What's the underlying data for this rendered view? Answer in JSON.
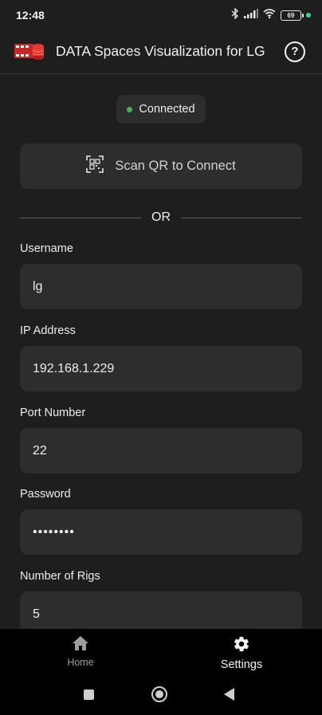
{
  "status_bar": {
    "time": "12:48",
    "battery": "69",
    "icons": [
      "bluetooth-icon",
      "signal-icon",
      "wifi-icon",
      "battery-icon"
    ]
  },
  "app_bar": {
    "title": "DATA Spaces Visualization for LG",
    "help_icon": "?"
  },
  "connection": {
    "status": "Connected",
    "status_color": "#4caf50"
  },
  "qr_button": {
    "label": "Scan QR to Connect",
    "icon": "qr-scan-icon"
  },
  "divider": {
    "label": "OR"
  },
  "form": {
    "username": {
      "label": "Username",
      "value": "lg"
    },
    "ip_address": {
      "label": "IP Address",
      "value": "192.168.1.229"
    },
    "port_number": {
      "label": "Port Number",
      "value": "22"
    },
    "password": {
      "label": "Password",
      "value": "••••••••"
    },
    "number_of_rigs": {
      "label": "Number of Rigs",
      "value": "5"
    }
  },
  "bottom_nav": {
    "items": [
      {
        "label": "Home",
        "icon": "home-icon",
        "active": false
      },
      {
        "label": "Settings",
        "icon": "gear-icon",
        "active": true
      }
    ]
  },
  "colors": {
    "background": "#1e1e1e",
    "surface": "#2d2d2d",
    "nav_background": "#000000",
    "accent_green": "#4caf50"
  }
}
